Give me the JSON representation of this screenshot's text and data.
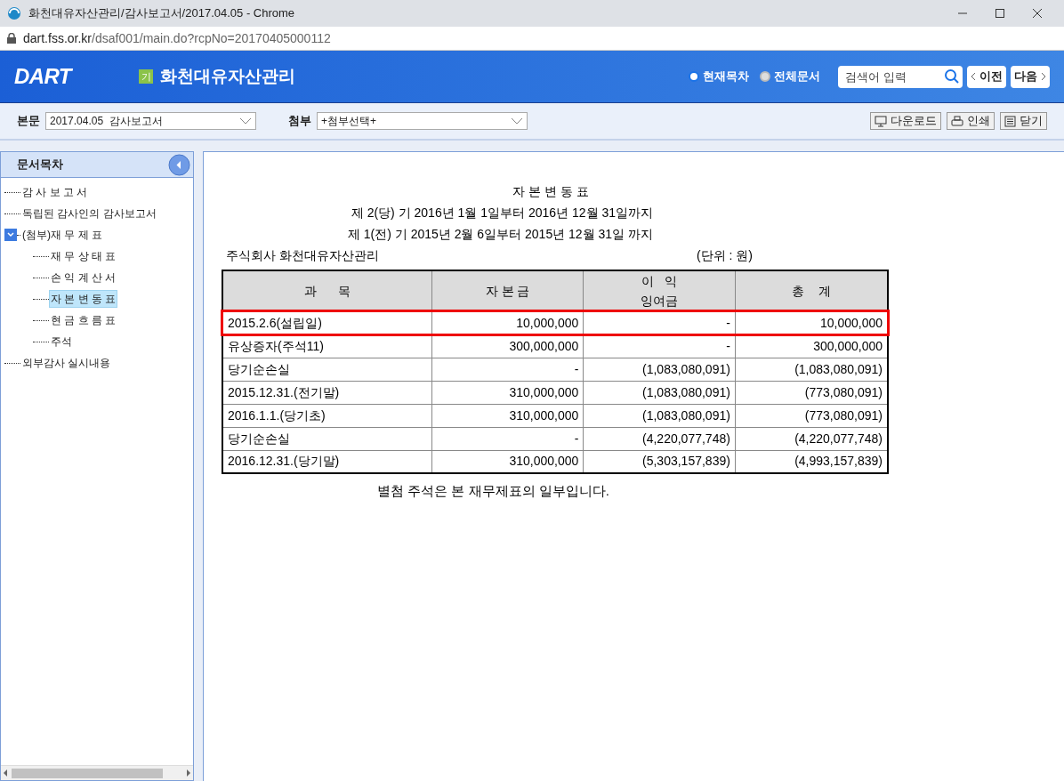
{
  "window": {
    "title": "화천대유자산관리/감사보고서/2017.04.05 - Chrome",
    "url_host": "dart.fss.or.kr",
    "url_path": "/dsaf001/main.do?rcpNo=20170405000112"
  },
  "header": {
    "logo": "DART",
    "company_badge": "기",
    "company": "화천대유자산관리",
    "scopes": [
      {
        "label": "현재목차",
        "selected": true
      },
      {
        "label": "전체문서",
        "selected": false
      }
    ],
    "search": {
      "placeholder": "검색어 입력"
    },
    "prev": "이전",
    "next": "다음"
  },
  "toolbar": {
    "main_label": "본문",
    "main_value": "2017.04.05  감사보고서",
    "attach_label": "첨부",
    "attach_value": "+첨부선택+",
    "buttons": [
      {
        "kind": "download",
        "label": "다운로드"
      },
      {
        "kind": "print",
        "label": "인쇄"
      },
      {
        "kind": "close",
        "label": "닫기"
      }
    ]
  },
  "sidebar": {
    "title": "문서목차",
    "items": [
      {
        "label": "감 사 보 고 서",
        "selected": false
      },
      {
        "label": "독립된 감사인의 감사보고서",
        "selected": false
      },
      {
        "label": "(첨부)재 무 제 표",
        "selected": false,
        "expanded": true,
        "children": [
          {
            "label": "재 무 상 태 표",
            "selected": false
          },
          {
            "label": "손 익 계 산 서",
            "selected": false
          },
          {
            "label": "자 본 변 동 표",
            "selected": true
          },
          {
            "label": "현 금 흐 름 표",
            "selected": false
          },
          {
            "label": "주석",
            "selected": false
          }
        ]
      },
      {
        "label": "외부감사 실시내용",
        "selected": false
      }
    ]
  },
  "document": {
    "title": "자 본 변 동 표",
    "periods": [
      "제 2(당) 기 2016년 1월 1일부터 2016년 12월 31일까지",
      "제 1(전) 기 2015년 2월 6일부터 2015년 12월 31일 까지"
    ],
    "company": "주식회사 화천대유자산관리",
    "unit": "(단위 : 원)",
    "table": {
      "columns": [
        "과      목",
        "자 본 금",
        "이   익\n잉여금",
        "총    계"
      ],
      "rows": [
        {
          "cells": [
            "2015.2.6(설립일)",
            "10,000,000",
            "-",
            "10,000,000"
          ],
          "highlighted": true
        },
        {
          "cells": [
            "유상증자(주석11)",
            "300,000,000",
            "-",
            "300,000,000"
          ],
          "highlighted": false
        },
        {
          "cells": [
            "당기순손실",
            "-",
            "(1,083,080,091)",
            "(1,083,080,091)"
          ],
          "highlighted": false
        },
        {
          "cells": [
            "2015.12.31.(전기말)",
            "310,000,000",
            "(1,083,080,091)",
            "(773,080,091)"
          ],
          "highlighted": false
        },
        {
          "cells": [
            "2016.1.1.(당기초)",
            "310,000,000",
            "(1,083,080,091)",
            "(773,080,091)"
          ],
          "highlighted": false
        },
        {
          "cells": [
            "당기순손실",
            "-",
            "(4,220,077,748)",
            "(4,220,077,748)"
          ],
          "highlighted": false
        },
        {
          "cells": [
            "2016.12.31.(당기말)",
            "310,000,000",
            "(5,303,157,839)",
            "(4,993,157,839)"
          ],
          "highlighted": false
        }
      ]
    },
    "note": "별첨 주석은 본 재무제표의 일부입니다."
  }
}
